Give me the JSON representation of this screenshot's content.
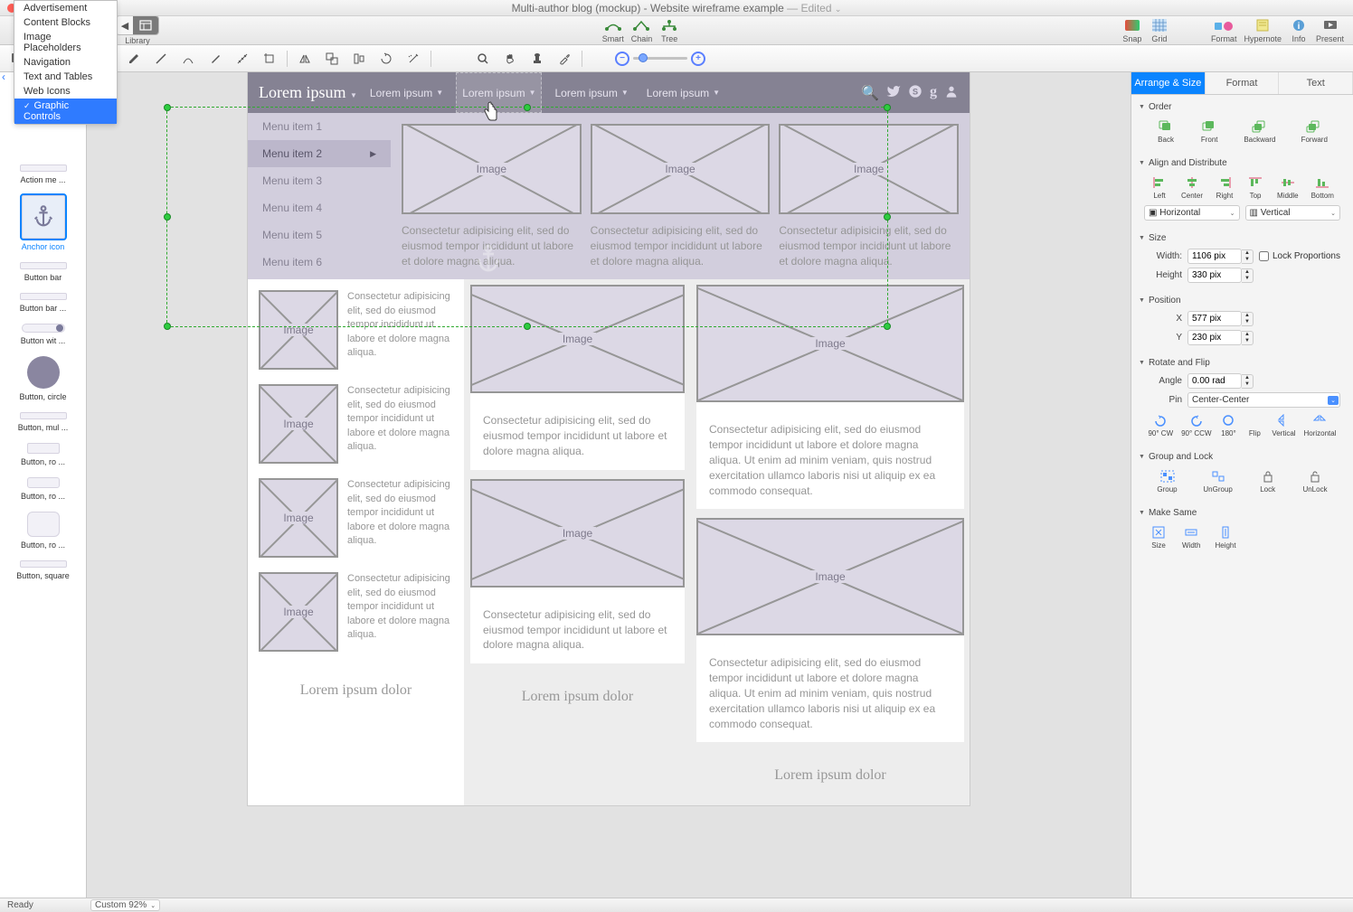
{
  "title": "Multi-author blog (mockup) - Website wireframe example",
  "title_suffix": "— Edited",
  "toolbar": {
    "library": "Library",
    "smart": "Smart",
    "chain": "Chain",
    "tree": "Tree",
    "snap": "Snap",
    "grid": "Grid",
    "format": "Format",
    "hypernote": "Hypernote",
    "info": "Info",
    "present": "Present"
  },
  "dropdown": {
    "items": [
      "Advertisement",
      "Content Blocks",
      "Image Placeholders",
      "Navigation",
      "Text and Tables",
      "Web Icons",
      "Graphic Controls"
    ],
    "selected": "Graphic Controls"
  },
  "library_items": [
    {
      "label": "Action me ..."
    },
    {
      "label": "Anchor icon",
      "selected": true,
      "anchor": true
    },
    {
      "label": "Button bar"
    },
    {
      "label": "Button bar ..."
    },
    {
      "label": "Button wit ..."
    },
    {
      "label": "Button, circle",
      "circle": true
    },
    {
      "label": "Button, mul ..."
    },
    {
      "label": "Button, ro ..."
    },
    {
      "label": "Button, ro ..."
    },
    {
      "label": "Button, ro ..."
    },
    {
      "label": "Button, square"
    }
  ],
  "wireframe": {
    "brand": "Lorem ipsum",
    "nav": [
      "Lorem ipsum",
      "Lorem ipsum",
      "Lorem ipsum",
      "Lorem ipsum"
    ],
    "menu": [
      "Menu item 1",
      "Menu item 2",
      "Menu item 3",
      "Menu item 4",
      "Menu item 5",
      "Menu item 6"
    ],
    "image_label": "Image",
    "lorem": "Consectetur adipisicing elit, sed do eiusmod tempor incididunt ut labore et dolore magna aliqua.",
    "lorem_long": "Consectetur adipisicing elit, sed do eiusmod tempor incididunt ut labore et dolore magna aliqua. Ut enim ad minim veniam, quis nostrud exercitation ullamco laboris nisi ut aliquip ex ea commodo consequat.",
    "footer": "Lorem ipsum dolor"
  },
  "inspector": {
    "tabs": [
      "Arrange & Size",
      "Format",
      "Text"
    ],
    "order": {
      "h": "Order",
      "back": "Back",
      "front": "Front",
      "backward": "Backward",
      "forward": "Forward"
    },
    "align": {
      "h": "Align and Distribute",
      "left": "Left",
      "center": "Center",
      "right": "Right",
      "top": "Top",
      "middle": "Middle",
      "bottom": "Bottom",
      "horizontal": "Horizontal",
      "vertical": "Vertical"
    },
    "size": {
      "h": "Size",
      "width_l": "Width:",
      "width": "1106 pix",
      "height_l": "Height",
      "height": "330 pix",
      "lock": "Lock Proportions"
    },
    "position": {
      "h": "Position",
      "x_l": "X",
      "x": "577 pix",
      "y_l": "Y",
      "y": "230 pix"
    },
    "rotate": {
      "h": "Rotate and Flip",
      "angle_l": "Angle",
      "angle": "0.00 rad",
      "pin_l": "Pin",
      "pin": "Center-Center",
      "cw": "90° CW",
      "ccw": "90° CCW",
      "r180": "180°",
      "flip": "Flip",
      "vert": "Vertical",
      "horiz": "Horizontal"
    },
    "group": {
      "h": "Group and Lock",
      "group": "Group",
      "ungroup": "UnGroup",
      "lock": "Lock",
      "unlock": "UnLock"
    },
    "same": {
      "h": "Make Same",
      "size": "Size",
      "width": "Width",
      "height": "Height"
    }
  },
  "status": {
    "ready": "Ready",
    "zoom": "Custom 92%"
  }
}
